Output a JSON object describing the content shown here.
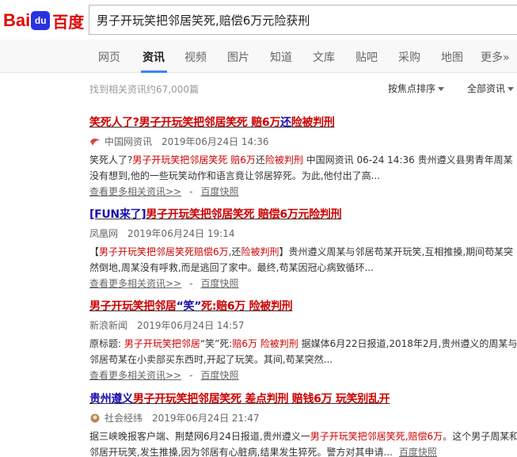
{
  "logo": {
    "bai": "Bai",
    "du": "du",
    "cn": "百度"
  },
  "search": {
    "query": "男子开玩笑把邻居笑死,赔偿6万元险获刑"
  },
  "nav": [
    {
      "label": "网页"
    },
    {
      "label": "资讯"
    },
    {
      "label": "视频"
    },
    {
      "label": "图片"
    },
    {
      "label": "知道"
    },
    {
      "label": "文库"
    },
    {
      "label": "贴吧"
    },
    {
      "label": "采购"
    },
    {
      "label": "地图"
    },
    {
      "label": "更多»"
    }
  ],
  "toolbar": {
    "count": "找到相关资讯约67,000篇",
    "sort_label": "按焦点排序",
    "type_label": "全部资讯"
  },
  "results": [
    {
      "title_parts": [
        "笑死人了?",
        "男子开玩笑把邻居笑死 赔6万",
        "还",
        "险被判刑"
      ],
      "source": "中国网资讯",
      "date": "2019年06月24日 14:36",
      "abstract": [
        "笑死人了?",
        "男子开玩笑把邻居笑死 赔6万",
        "还",
        "险被判刑",
        " 中国网资讯 06-24 14:36 贵州遵义县男青年周某没有想到,他的一些玩笑动作和语言竟让邻居猝死。为此,他付出了高..."
      ],
      "more": "查看更多相关资讯>>",
      "dash": "-",
      "cache": "百度快照"
    },
    {
      "title_parts": [
        "[FUN来了]",
        "男子开玩笑把邻居笑死 赔偿6万元险判刑"
      ],
      "source": "凤凰网",
      "date": "2019年06月24日 19:14",
      "abstract": [
        "【",
        "男子开玩笑把邻居笑死赔偿6万",
        ",还",
        "险被判刑",
        "】贵州遵义周某与邻居苟某开玩笑,互相推搡,期间苟某突然倒地,周某没有呼救,而是逃回了家中。最终,苟某因冠心病致循环..."
      ],
      "more": "查看更多相关资讯>>",
      "dash": "-",
      "cache": "百度快照"
    },
    {
      "title_parts": [
        "男子开玩笑把邻居",
        "“笑”",
        "死:赔6万 险被判刑"
      ],
      "source": "新浪新闻",
      "date": "2019年06月24日 14:57",
      "abstract": [
        "原标题: ",
        "男子开玩笑把邻居",
        "“笑”死:",
        "赔6万 险被判刑",
        " 据媒体6月22日报道,2018年2月,贵州遵义的周某与邻居苟某在小卖部买东西时,开起了玩笑。其间,苟某突然..."
      ],
      "more": "查看更多相关资讯>>",
      "dash": "-",
      "cache": "百度快照"
    },
    {
      "title_parts": [
        "贵州遵义",
        "男子开玩笑把邻居笑死 差点判刑 赔钱6万 玩笑别乱开"
      ],
      "source": "社会经纬",
      "date": "2019年06月24日 21:47",
      "abstract": [
        "据三峡晚报客户端、荆楚网6月24日报道,贵州遵义一",
        "男子开玩笑把邻居笑死,赔偿6万",
        "。这个男子周某和邻居开玩笑,发生推搡,因为邻居有心脏病,结果发生猝死。警方对其申请..."
      ],
      "cache": "百度快照"
    }
  ]
}
